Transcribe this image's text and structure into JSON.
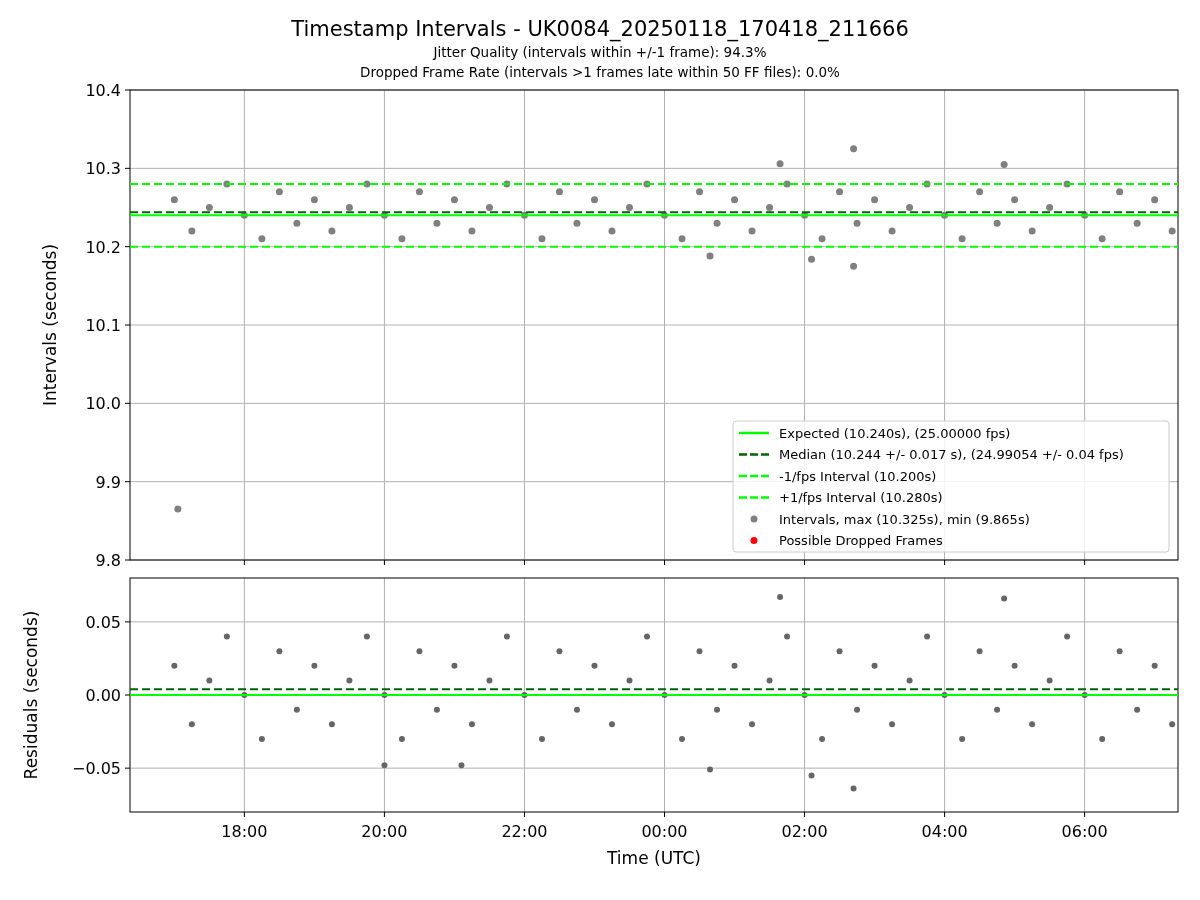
{
  "figure": {
    "title": "Timestamp Intervals - UK0084_20250118_170418_211666",
    "subtitles": [
      "Jitter Quality (intervals within +/-1 frame): 94.3%",
      "Dropped Frame Rate (intervals >1 frames late within 50 FF files): 0.0%"
    ]
  },
  "intervals_panel": {
    "chart_data": {
      "type": "scatter",
      "ylabel": "Intervals (seconds)",
      "grid": true,
      "legend": "lower right",
      "xlim": [
        "2025-01-18T16:22",
        "2025-01-19T07:20"
      ],
      "ylim": [
        9.8,
        10.4
      ],
      "yticks": [
        {
          "value": 9.8,
          "label": "9.8"
        },
        {
          "value": 9.9,
          "label": "9.9"
        },
        {
          "value": 10.0,
          "label": "10.0"
        },
        {
          "value": 10.1,
          "label": "10.1"
        },
        {
          "value": 10.2,
          "label": "10.2"
        },
        {
          "value": 10.3,
          "label": "10.3"
        },
        {
          "value": 10.4,
          "label": "10.4"
        }
      ],
      "ref_lines": [
        {
          "axis": "y",
          "value": 10.24,
          "label": "Expected (10.240s), (25.00000 fps)",
          "color": "#00ff00"
        },
        {
          "axis": "y",
          "value": 10.244,
          "label": "Median (10.244 +/- 0.017 s), (24.99054 +/- 0.04 fps)",
          "color": "#006400"
        },
        {
          "axis": "y",
          "value": 10.2,
          "label": "-1/fps Interval (10.200s)",
          "color": "#00ff00"
        },
        {
          "axis": "y",
          "value": 10.28,
          "label": "+1/fps Interval (10.280s)",
          "color": "#00ff00"
        }
      ],
      "series": [
        {
          "name": "Intervals, max (10.325s), min (9.865s)",
          "color": "#808080",
          "x": [
            "2025-01-18T17:00",
            "2025-01-18T17:15",
            "2025-01-18T17:30",
            "2025-01-18T17:45",
            "2025-01-18T18:00",
            "2025-01-18T18:15",
            "2025-01-18T18:30",
            "2025-01-18T18:45",
            "2025-01-18T19:00",
            "2025-01-18T19:15",
            "2025-01-18T19:30",
            "2025-01-18T19:45",
            "2025-01-18T20:00",
            "2025-01-18T20:15",
            "2025-01-18T20:30",
            "2025-01-18T20:45",
            "2025-01-18T21:00",
            "2025-01-18T21:15",
            "2025-01-18T21:30",
            "2025-01-18T21:45",
            "2025-01-18T22:00",
            "2025-01-18T22:15",
            "2025-01-18T22:30",
            "2025-01-18T22:45",
            "2025-01-18T23:00",
            "2025-01-18T23:15",
            "2025-01-18T23:30",
            "2025-01-18T23:45",
            "2025-01-19T00:00",
            "2025-01-19T00:15",
            "2025-01-19T00:30",
            "2025-01-19T00:45",
            "2025-01-19T01:00",
            "2025-01-19T01:15",
            "2025-01-19T01:30",
            "2025-01-19T01:45",
            "2025-01-19T02:00",
            "2025-01-19T02:15",
            "2025-01-19T02:30",
            "2025-01-19T02:45",
            "2025-01-19T03:00",
            "2025-01-19T03:15",
            "2025-01-19T03:30",
            "2025-01-19T03:45",
            "2025-01-19T04:00",
            "2025-01-19T04:15",
            "2025-01-19T04:30",
            "2025-01-19T04:45",
            "2025-01-19T05:00",
            "2025-01-19T05:15",
            "2025-01-19T05:30",
            "2025-01-19T05:45",
            "2025-01-19T06:00",
            "2025-01-19T06:15",
            "2025-01-19T06:30",
            "2025-01-19T06:45",
            "2025-01-19T07:00",
            "2025-01-19T07:15",
            "2025-01-18T17:03",
            "2025-01-19T02:42",
            "2025-01-19T01:39",
            "2025-01-19T04:51",
            "2025-01-19T02:42",
            "2025-01-19T00:39",
            "2025-01-19T02:06"
          ],
          "values": [
            10.26,
            10.22,
            10.25,
            10.28,
            10.24,
            10.21,
            10.27,
            10.23,
            10.26,
            10.22,
            10.25,
            10.28,
            10.24,
            10.21,
            10.27,
            10.23,
            10.26,
            10.22,
            10.25,
            10.28,
            10.24,
            10.21,
            10.27,
            10.23,
            10.26,
            10.22,
            10.25,
            10.28,
            10.24,
            10.21,
            10.27,
            10.23,
            10.26,
            10.22,
            10.25,
            10.28,
            10.24,
            10.21,
            10.27,
            10.23,
            10.26,
            10.22,
            10.25,
            10.28,
            10.24,
            10.21,
            10.27,
            10.23,
            10.26,
            10.22,
            10.25,
            10.28,
            10.24,
            10.21,
            10.27,
            10.23,
            10.26,
            10.22,
            9.865,
            10.325,
            10.306,
            10.305,
            10.175,
            10.188,
            10.184
          ]
        },
        {
          "name": "Possible Dropped Frames",
          "color": "#ff0000"
        }
      ]
    }
  },
  "residuals_panel": {
    "chart_data": {
      "type": "scatter",
      "ylabel": "Residuals (seconds)",
      "xlabel": "Time (UTC)",
      "grid": true,
      "xlim": [
        "2025-01-18T16:22",
        "2025-01-19T07:20"
      ],
      "ylim": [
        -0.08,
        0.08
      ],
      "xticks": [
        {
          "value": "2025-01-18T18:00",
          "label": "18:00"
        },
        {
          "value": "2025-01-18T20:00",
          "label": "20:00"
        },
        {
          "value": "2025-01-18T22:00",
          "label": "22:00"
        },
        {
          "value": "2025-01-19T00:00",
          "label": "00:00"
        },
        {
          "value": "2025-01-19T02:00",
          "label": "02:00"
        },
        {
          "value": "2025-01-19T04:00",
          "label": "04:00"
        },
        {
          "value": "2025-01-19T06:00",
          "label": "06:00"
        }
      ],
      "yticks": [
        {
          "value": -0.05,
          "label": "−0.05"
        },
        {
          "value": 0,
          "label": "0.00"
        },
        {
          "value": 0.05,
          "label": "0.05"
        }
      ],
      "ref_lines": [
        {
          "axis": "y",
          "value": 0,
          "color": "#00ff00"
        },
        {
          "axis": "y",
          "value": 0.004,
          "color": "#006400"
        }
      ],
      "series": [
        {
          "color": "#666666",
          "x": [
            "2025-01-18T17:00",
            "2025-01-18T17:15",
            "2025-01-18T17:30",
            "2025-01-18T17:45",
            "2025-01-18T18:00",
            "2025-01-18T18:15",
            "2025-01-18T18:30",
            "2025-01-18T18:45",
            "2025-01-18T19:00",
            "2025-01-18T19:15",
            "2025-01-18T19:30",
            "2025-01-18T19:45",
            "2025-01-18T20:00",
            "2025-01-18T20:15",
            "2025-01-18T20:30",
            "2025-01-18T20:45",
            "2025-01-18T21:00",
            "2025-01-18T21:15",
            "2025-01-18T21:30",
            "2025-01-18T21:45",
            "2025-01-18T22:00",
            "2025-01-18T22:15",
            "2025-01-18T22:30",
            "2025-01-18T22:45",
            "2025-01-18T23:00",
            "2025-01-18T23:15",
            "2025-01-18T23:30",
            "2025-01-18T23:45",
            "2025-01-19T00:00",
            "2025-01-19T00:15",
            "2025-01-19T00:30",
            "2025-01-19T00:45",
            "2025-01-19T01:00",
            "2025-01-19T01:15",
            "2025-01-19T01:30",
            "2025-01-19T01:45",
            "2025-01-19T02:00",
            "2025-01-19T02:15",
            "2025-01-19T02:30",
            "2025-01-19T02:45",
            "2025-01-19T03:00",
            "2025-01-19T03:15",
            "2025-01-19T03:30",
            "2025-01-19T03:45",
            "2025-01-19T04:00",
            "2025-01-19T04:15",
            "2025-01-19T04:30",
            "2025-01-19T04:45",
            "2025-01-19T05:00",
            "2025-01-19T05:15",
            "2025-01-19T05:30",
            "2025-01-19T05:45",
            "2025-01-19T06:00",
            "2025-01-19T06:15",
            "2025-01-19T06:30",
            "2025-01-19T06:45",
            "2025-01-19T07:00",
            "2025-01-19T07:15",
            "2025-01-19T01:39",
            "2025-01-19T04:51",
            "2025-01-19T02:42",
            "2025-01-19T00:39",
            "2025-01-19T02:06",
            "2025-01-18T20:00",
            "2025-01-18T21:06"
          ],
          "values": [
            0.02,
            -0.02,
            0.01,
            0.04,
            0,
            -0.03,
            0.03,
            -0.01,
            0.02,
            -0.02,
            0.01,
            0.04,
            0,
            -0.03,
            0.03,
            -0.01,
            0.02,
            -0.02,
            0.01,
            0.04,
            0,
            -0.03,
            0.03,
            -0.01,
            0.02,
            -0.02,
            0.01,
            0.04,
            0,
            -0.03,
            0.03,
            -0.01,
            0.02,
            -0.02,
            0.01,
            0.04,
            0,
            -0.03,
            0.03,
            -0.01,
            0.02,
            -0.02,
            0.01,
            0.04,
            0,
            -0.03,
            0.03,
            -0.01,
            0.02,
            -0.02,
            0.01,
            0.04,
            0,
            -0.03,
            0.03,
            -0.01,
            0.02,
            -0.02,
            0.067,
            0.066,
            -0.064,
            -0.051,
            -0.055,
            -0.048,
            -0.048
          ]
        }
      ]
    }
  }
}
